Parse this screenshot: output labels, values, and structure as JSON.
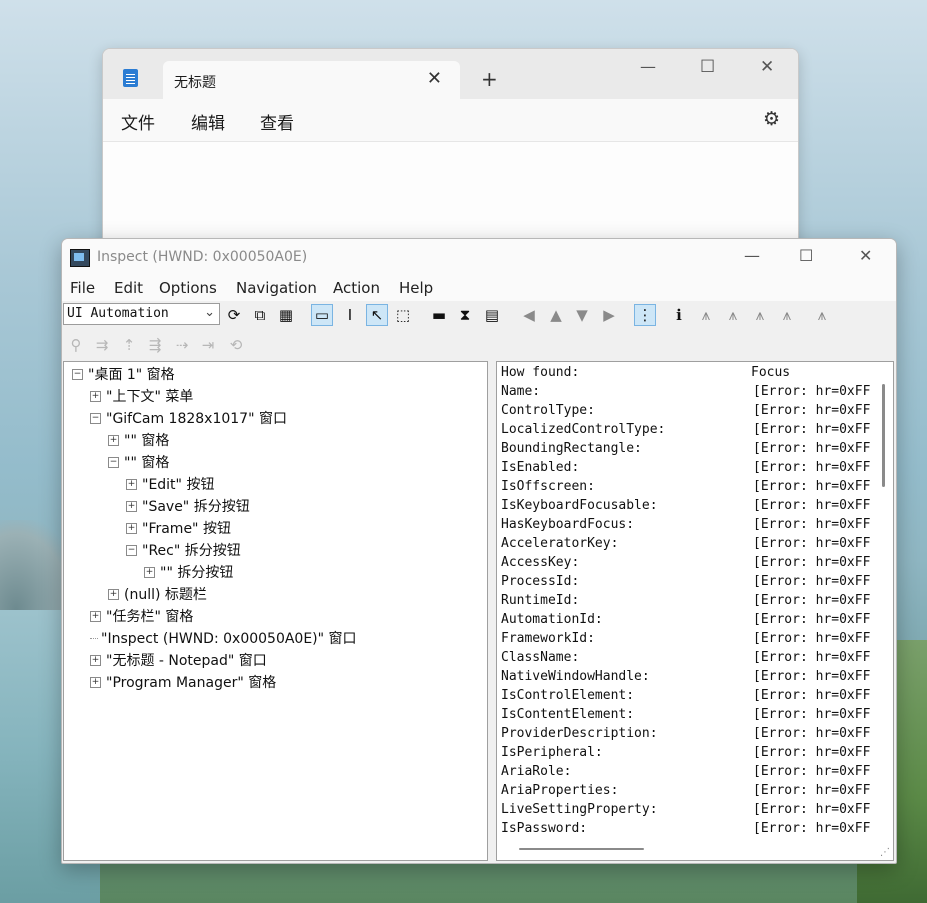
{
  "notepad": {
    "tab_title": "无标题",
    "tab_close": "✕",
    "new_tab": "+",
    "minimize": "—",
    "maximize": "☐",
    "close": "✕",
    "menus": [
      "文件",
      "编辑",
      "查看"
    ],
    "settings_icon": "⚙"
  },
  "inspect": {
    "title": "Inspect  (HWND: 0x00050A0E)",
    "minimize": "—",
    "maximize": "☐",
    "close": "✕",
    "menus": [
      "File",
      "Edit",
      "Options",
      "Navigation",
      "Action",
      "Help"
    ],
    "mode_select": "UI Automation",
    "tree": [
      {
        "label": "\"桌面 1\" 窗格",
        "indent": 0,
        "expander": "⊟"
      },
      {
        "label": "\"上下文\" 菜单",
        "indent": 1,
        "expander": "⊞"
      },
      {
        "label": "\"GifCam 1828x1017\" 窗口",
        "indent": 1,
        "expander": "⊟"
      },
      {
        "label": "\"\" 窗格",
        "indent": 2,
        "expander": "⊞"
      },
      {
        "label": "\"\" 窗格",
        "indent": 2,
        "expander": "⊟"
      },
      {
        "label": "\"Edit\" 按钮",
        "indent": 3,
        "expander": "⊞"
      },
      {
        "label": "\"Save\" 拆分按钮",
        "indent": 3,
        "expander": "⊞"
      },
      {
        "label": "\"Frame\" 按钮",
        "indent": 3,
        "expander": "⊞"
      },
      {
        "label": "\"Rec\" 拆分按钮",
        "indent": 3,
        "expander": "⊟"
      },
      {
        "label": "\"\" 拆分按钮",
        "indent": 4,
        "expander": "⊞"
      },
      {
        "label": "(null) 标题栏",
        "indent": 2,
        "expander": "⊞"
      },
      {
        "label": "\"任务栏\" 窗格",
        "indent": 1,
        "expander": "⊞"
      },
      {
        "label": "\"Inspect  (HWND: 0x00050A0E)\" 窗口",
        "indent": 1,
        "expander": ""
      },
      {
        "label": "\"无标题 - Notepad\" 窗口",
        "indent": 1,
        "expander": "⊞"
      },
      {
        "label": "\"Program Manager\" 窗格",
        "indent": 1,
        "expander": "⊞"
      }
    ],
    "properties": [
      {
        "name": "How found:",
        "value": "Focus"
      },
      {
        "name": "Name:",
        "value": "[Error: hr=0xFF"
      },
      {
        "name": "ControlType:",
        "value": "[Error: hr=0xFF"
      },
      {
        "name": "LocalizedControlType:",
        "value": "[Error: hr=0xFF"
      },
      {
        "name": "BoundingRectangle:",
        "value": "[Error: hr=0xFF"
      },
      {
        "name": "IsEnabled:",
        "value": "[Error: hr=0xFF"
      },
      {
        "name": "IsOffscreen:",
        "value": "[Error: hr=0xFF"
      },
      {
        "name": "IsKeyboardFocusable:",
        "value": "[Error: hr=0xFF"
      },
      {
        "name": "HasKeyboardFocus:",
        "value": "[Error: hr=0xFF"
      },
      {
        "name": "AcceleratorKey:",
        "value": "[Error: hr=0xFF"
      },
      {
        "name": "AccessKey:",
        "value": "[Error: hr=0xFF"
      },
      {
        "name": "ProcessId:",
        "value": "[Error: hr=0xFF"
      },
      {
        "name": "RuntimeId:",
        "value": "[Error: hr=0xFF"
      },
      {
        "name": "AutomationId:",
        "value": "[Error: hr=0xFF"
      },
      {
        "name": "FrameworkId:",
        "value": "[Error: hr=0xFF"
      },
      {
        "name": "ClassName:",
        "value": "[Error: hr=0xFF"
      },
      {
        "name": "NativeWindowHandle:",
        "value": "[Error: hr=0xFF"
      },
      {
        "name": "IsControlElement:",
        "value": "[Error: hr=0xFF"
      },
      {
        "name": "IsContentElement:",
        "value": "[Error: hr=0xFF"
      },
      {
        "name": "ProviderDescription:",
        "value": "[Error: hr=0xFF"
      },
      {
        "name": "IsPeripheral:",
        "value": "[Error: hr=0xFF"
      },
      {
        "name": "AriaRole:",
        "value": "[Error: hr=0xFF"
      },
      {
        "name": "AriaProperties:",
        "value": "[Error: hr=0xFF"
      },
      {
        "name": "LiveSettingProperty:",
        "value": "[Error: hr=0xFF"
      },
      {
        "name": "IsPassword:",
        "value": "[Error: hr=0xFF"
      }
    ],
    "colors": {
      "selection": "#cde6f7",
      "border": "#9f9f9f"
    }
  }
}
